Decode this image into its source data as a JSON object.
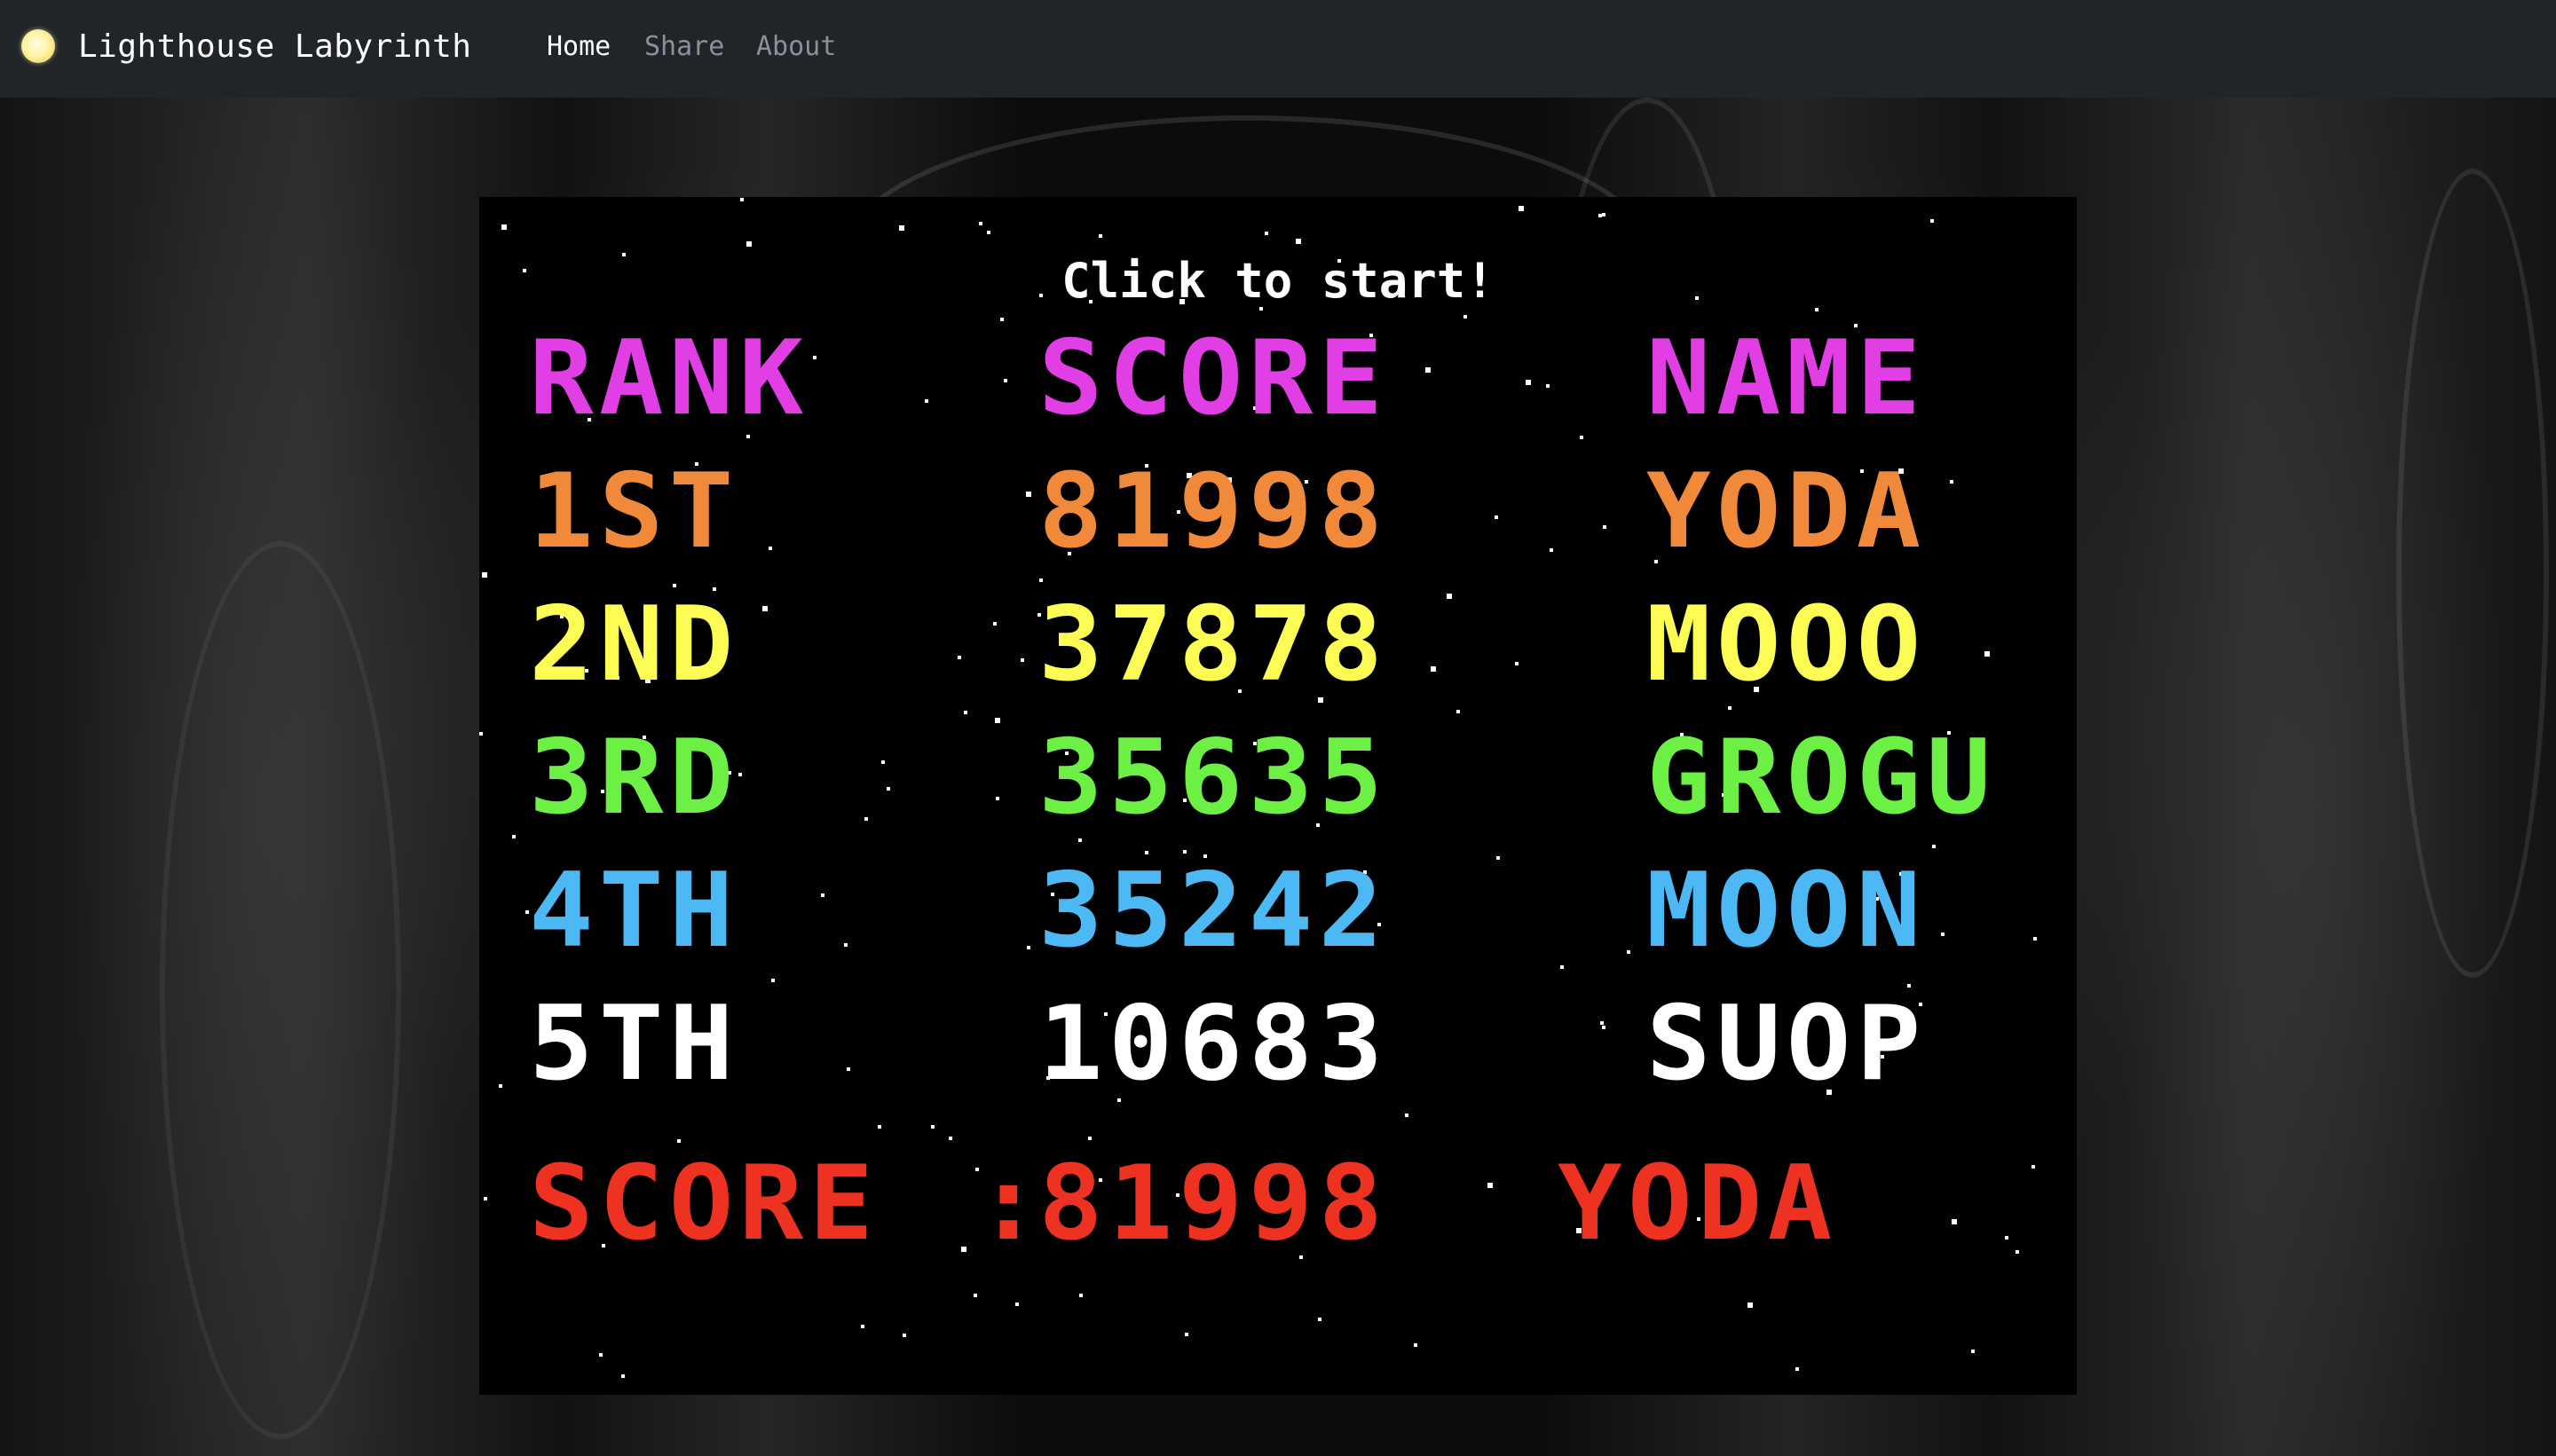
{
  "navbar": {
    "logo_icon": "lighthouse-light-icon",
    "title": "Lighthouse Labyrinth",
    "links": [
      {
        "label": "Home",
        "active": true
      },
      {
        "label": "Share",
        "active": false
      },
      {
        "label": "About",
        "active": false
      }
    ]
  },
  "game": {
    "prompt": "Click to start!",
    "headers": {
      "rank": "RANK",
      "score": "SCORE",
      "name": "NAME"
    },
    "header_color": "#e23ee6",
    "leaderboard": [
      {
        "rank": "1ST",
        "score": "81998",
        "name": "YODA",
        "color": "#f08a3a"
      },
      {
        "rank": "2ND",
        "score": "37878",
        "name": "MOOO",
        "color": "#fcfc54"
      },
      {
        "rank": "3RD",
        "score": "35635",
        "name": "GROGU",
        "color": "#6cf044"
      },
      {
        "rank": "4TH",
        "score": "35242",
        "name": "MOON",
        "color": "#4cb8f4"
      },
      {
        "rank": "5TH",
        "score": "10683",
        "name": "SUOP",
        "color": "#ffffff"
      }
    ],
    "current": {
      "label": "SCORE",
      "separator": ":",
      "score": "81998",
      "name": "YODA",
      "color": "#ee3222"
    }
  }
}
